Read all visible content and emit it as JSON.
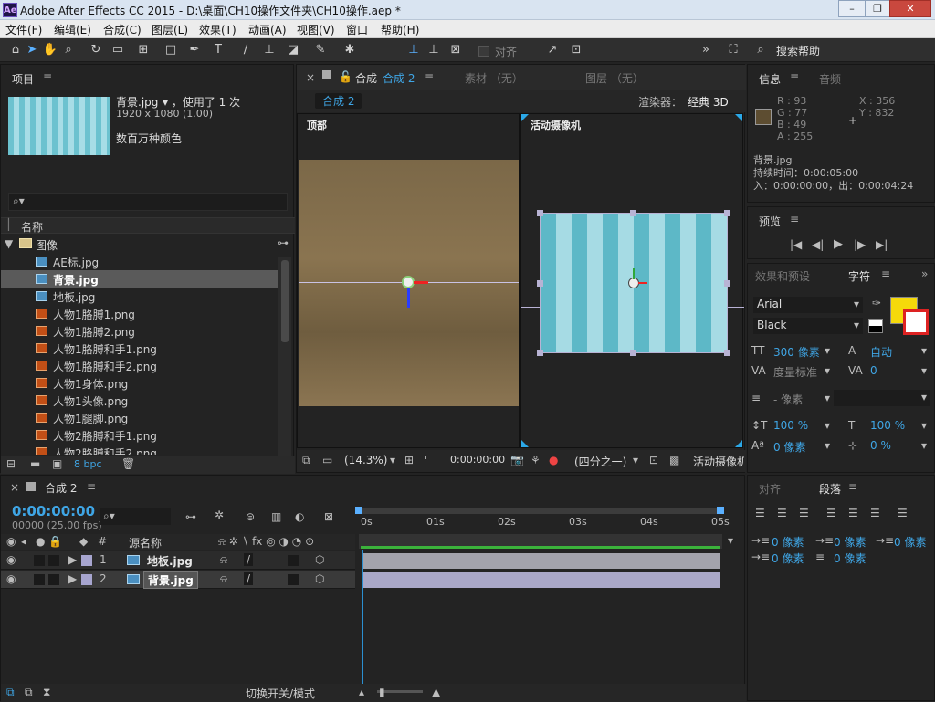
{
  "window": {
    "title": "Adobe After Effects CC 2015 - D:\\桌面\\CH10操作文件夹\\CH10操作.aep *"
  },
  "menu": [
    "文件(F)",
    "编辑(E)",
    "合成(C)",
    "图层(L)",
    "效果(T)",
    "动画(A)",
    "视图(V)",
    "窗口",
    "帮助(H)"
  ],
  "toolbar": {
    "align_label": "对齐",
    "search_help": "搜索帮助"
  },
  "project": {
    "title": "项目",
    "file_name": "背景.jpg",
    "used": "，使用了 1 次",
    "dims": "1920 x 1080 (1.00)",
    "colors": "数百万种颜色",
    "search_placeholder": "",
    "col_name": "名称",
    "folder": "图像",
    "items": [
      {
        "label": "AE标.jpg",
        "type": "jpg"
      },
      {
        "label": "背景.jpg",
        "type": "jpg",
        "selected": true
      },
      {
        "label": "地板.jpg",
        "type": "jpg"
      },
      {
        "label": "人物1胳膊1.png",
        "type": "png"
      },
      {
        "label": "人物1胳膊2.png",
        "type": "png"
      },
      {
        "label": "人物1胳膊和手1.png",
        "type": "png"
      },
      {
        "label": "人物1胳膊和手2.png",
        "type": "png"
      },
      {
        "label": "人物1身体.png",
        "type": "png"
      },
      {
        "label": "人物1头像.png",
        "type": "png"
      },
      {
        "label": "人物1腿脚.png",
        "type": "png"
      },
      {
        "label": "人物2胳膊和手1.png",
        "type": "png"
      },
      {
        "label": "人物2胳膊和手2.png",
        "type": "png"
      }
    ],
    "bpc": "8 bpc"
  },
  "comp": {
    "tab_prefix": "合成",
    "tab_name": "合成 2",
    "footage_tab": "素材 （无）",
    "layer_tab": "图层 （无）",
    "breadcrumb": "合成 2",
    "renderer_label": "渲染器：",
    "renderer": "经典 3D",
    "view_left": "顶部",
    "view_right": "活动摄像机",
    "zoom": "(14.3%)",
    "timecode": "0:00:00:00",
    "quality": "(四分之一)",
    "camera": "活动摄像机"
  },
  "info": {
    "tab": "信息",
    "audio_tab": "音频",
    "r": "R : 93",
    "g": "G : 77",
    "b": "B : 49",
    "a": "A : 255",
    "x": "X : 356",
    "y": "Y : 832",
    "file": "背景.jpg",
    "duration": "持续时间：0:00:05:00",
    "inout": "入：0:00:00:00，出：0:00:04:24",
    "swatch": "#5d4d31"
  },
  "preview": {
    "tab": "预览"
  },
  "character": {
    "effects_tab": "效果和预设",
    "char_tab": "字符",
    "font": "Arial",
    "style": "Black",
    "fill": "#f5d90a",
    "size": "300 像素",
    "leading": "自动",
    "kerning": "度量标准",
    "tracking": "0",
    "stroke": "- 像素",
    "vscale": "100 %",
    "hscale": "100 %",
    "baseline": "0 像素",
    "tsume": "0 %"
  },
  "paragraph": {
    "align_tab": "对齐",
    "para_tab": "段落",
    "indent_left": "0 像素",
    "indent_first": "0 像素",
    "indent_right": "0 像素",
    "space_before": "0 像素",
    "space_after": "0 像素"
  },
  "timeline": {
    "tab": "合成 2",
    "timecode": "0:00:00:00",
    "fps": "00000 (25.00 fps)",
    "col_name": "源名称",
    "col_num": "#",
    "ticks": [
      "0s",
      "01s",
      "02s",
      "03s",
      "04s",
      "05s"
    ],
    "layers": [
      {
        "num": "1",
        "name": "地板.jpg"
      },
      {
        "num": "2",
        "name": "背景.jpg"
      }
    ],
    "footer": "切换开关/模式"
  }
}
